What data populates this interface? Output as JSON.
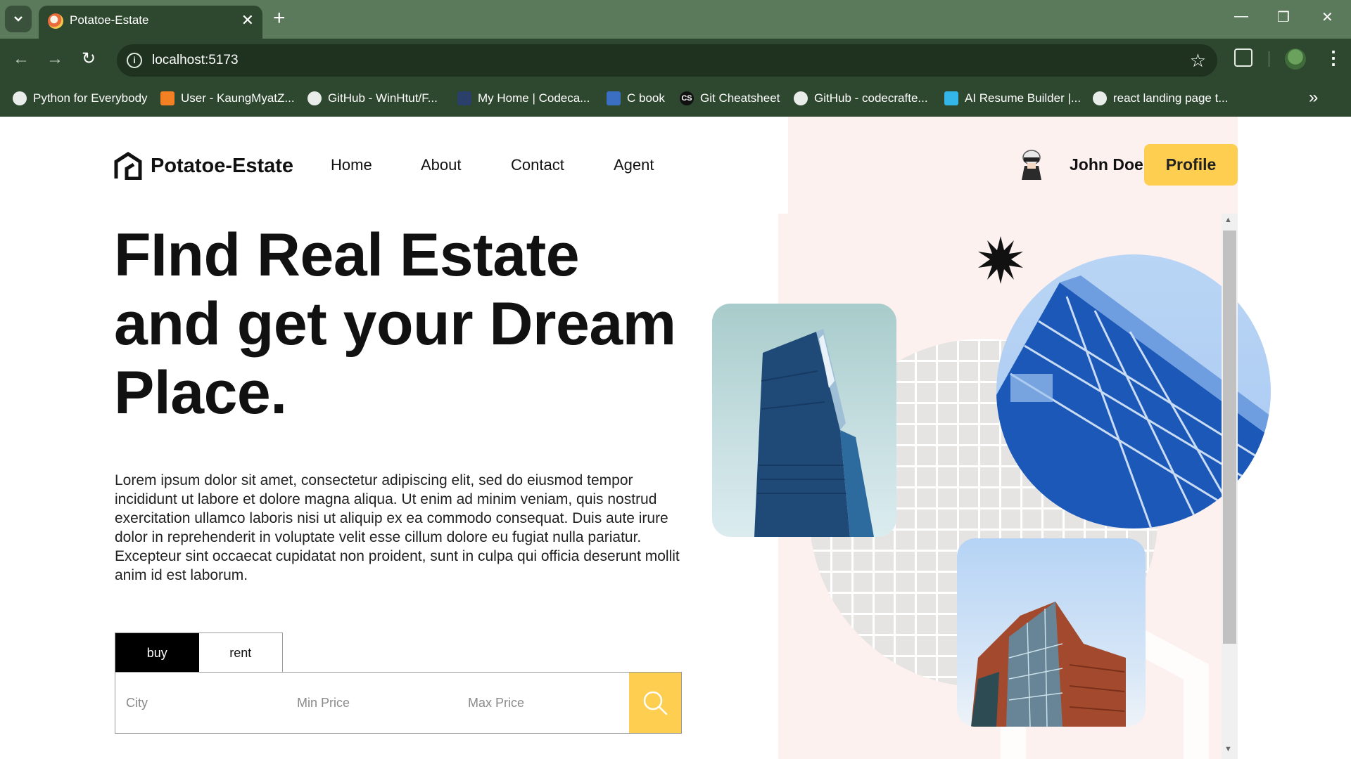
{
  "browser": {
    "tab_title": "Potatoe-Estate",
    "tab_close": "✕",
    "new_tab": "+",
    "url": "localhost:5173",
    "window_controls": [
      "—",
      "❐",
      "✕"
    ],
    "bookmarks": [
      {
        "label": "Python for Everybody",
        "icon": "globe-icon"
      },
      {
        "label": "User - KaungMyatZ...",
        "icon": "stackoverflow-icon"
      },
      {
        "label": "GitHub - WinHtut/F...",
        "icon": "github-icon"
      },
      {
        "label": "My Home | Codeca...",
        "icon": "codecademy-icon"
      },
      {
        "label": "C book",
        "icon": "book-icon"
      },
      {
        "label": "Git Cheatsheet",
        "icon": "cs-icon",
        "icon_text": "CS"
      },
      {
        "label": "GitHub - codecrafte...",
        "icon": "github-icon"
      },
      {
        "label": "AI Resume Builder |...",
        "icon": "resume-icon"
      },
      {
        "label": "react landing page t...",
        "icon": "github-icon"
      }
    ],
    "bookmarks_more": "»"
  },
  "nav": {
    "brand": "Potatoe-Estate",
    "links": [
      "Home",
      "About",
      "Contact",
      "Agent"
    ],
    "user_name": "John Doe",
    "profile_button": "Profile"
  },
  "hero": {
    "title": "FInd Real Estate and get your Dream Place.",
    "description": "Lorem ipsum dolor sit amet, consectetur adipiscing elit, sed do eiusmod tempor incididunt ut labore et dolore magna aliqua. Ut enim ad minim veniam, quis nostrud exercitation ullamco laboris nisi ut aliquip ex ea commodo consequat. Duis aute irure dolor in reprehenderit in voluptate velit esse cillum dolore eu fugiat nulla pariatur. Excepteur sint occaecat cupidatat non proident, sunt in culpa qui officia deserunt mollit anim id est laborum."
  },
  "search": {
    "tabs": [
      "buy",
      "rent"
    ],
    "active_tab": "buy",
    "city_placeholder": "City",
    "min_price_placeholder": "Min Price",
    "max_price_placeholder": "Max Price"
  },
  "colors": {
    "accent": "#fece51",
    "chrome": "#2e472f",
    "tabbar": "#5b7a5c",
    "right_panel": "#fcf1ef"
  }
}
